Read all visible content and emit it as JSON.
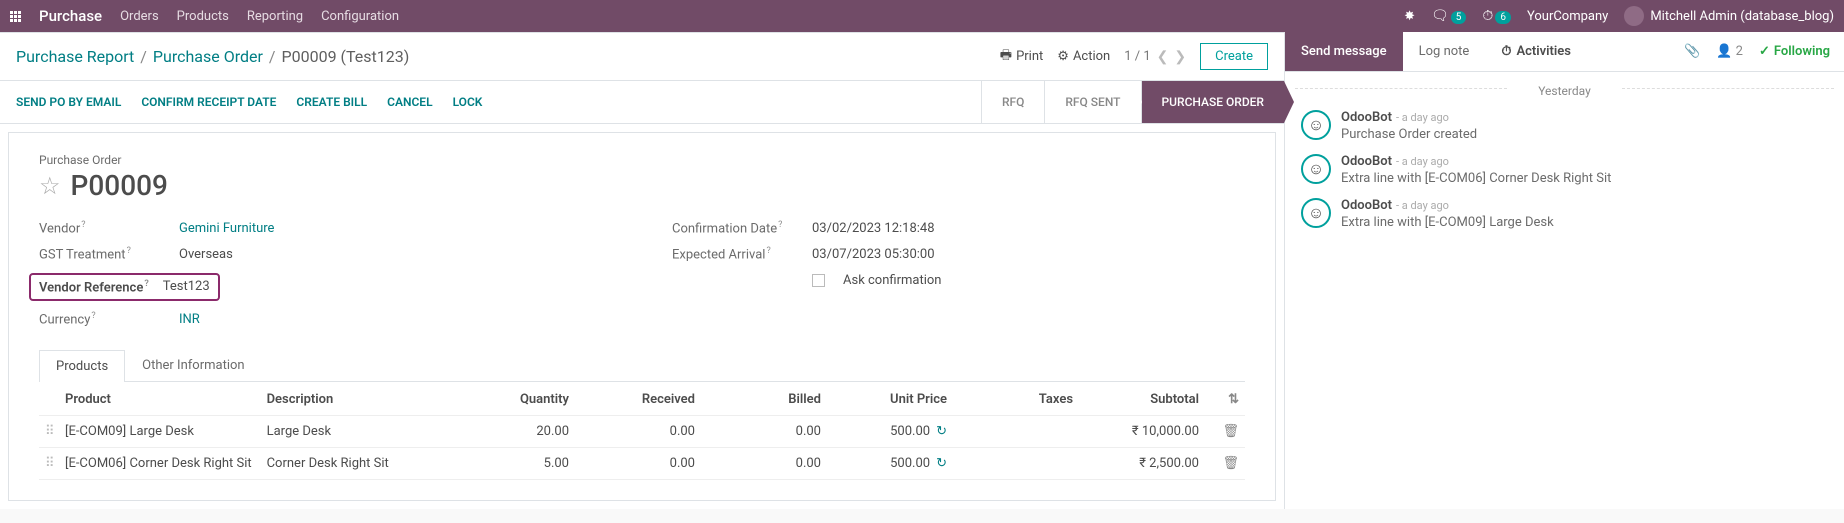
{
  "topbar": {
    "app": "Purchase",
    "menus": [
      "Orders",
      "Products",
      "Reporting",
      "Configuration"
    ],
    "messages_count": "5",
    "activities_count": "6",
    "company": "YourCompany",
    "user": "Mitchell Admin (database_blog)"
  },
  "breadcrumb": {
    "root": "Purchase Report",
    "mid": "Purchase Order",
    "current": "P00009 (Test123)"
  },
  "subhead": {
    "print": "Print",
    "action": "Action",
    "pager": "1 / 1",
    "create": "Create"
  },
  "status_actions": {
    "send_po": "SEND PO BY EMAIL",
    "confirm_date": "CONFIRM RECEIPT DATE",
    "create_bill": "CREATE BILL",
    "cancel": "CANCEL",
    "lock": "LOCK"
  },
  "status_steps": {
    "rfq": "RFQ",
    "rfq_sent": "RFQ SENT",
    "po": "PURCHASE ORDER"
  },
  "form": {
    "title_label": "Purchase Order",
    "title": "P00009",
    "labels": {
      "vendor": "Vendor",
      "gst": "GST Treatment",
      "vendor_ref": "Vendor Reference",
      "currency": "Currency",
      "confirm_date": "Confirmation Date",
      "expected": "Expected Arrival",
      "ask_conf": "Ask confirmation"
    },
    "values": {
      "vendor": "Gemini Furniture",
      "gst": "Overseas",
      "vendor_ref": "Test123",
      "currency": "INR",
      "confirm_date": "03/02/2023 12:18:48",
      "expected": "03/07/2023 05:30:00"
    }
  },
  "tabs": {
    "products": "Products",
    "other": "Other Information"
  },
  "grid": {
    "headers": {
      "product": "Product",
      "desc": "Description",
      "qty": "Quantity",
      "recv": "Received",
      "bill": "Billed",
      "price": "Unit Price",
      "tax": "Taxes",
      "sub": "Subtotal"
    },
    "rows": [
      {
        "product": "[E-COM09] Large Desk",
        "desc": "Large Desk",
        "qty": "20.00",
        "recv": "0.00",
        "bill": "0.00",
        "price": "500.00",
        "sub": "₹ 10,000.00"
      },
      {
        "product": "[E-COM06] Corner Desk Right Sit",
        "desc": "Corner Desk Right Sit",
        "qty": "5.00",
        "recv": "0.00",
        "bill": "0.00",
        "price": "500.00",
        "sub": "₹ 2,500.00"
      }
    ]
  },
  "chatter": {
    "send": "Send message",
    "log": "Log note",
    "activities": "Activities",
    "followers": "2",
    "following": "Following",
    "day": "Yesterday",
    "items": [
      {
        "author": "OdooBot",
        "time": "a day ago",
        "text": "Purchase Order created"
      },
      {
        "author": "OdooBot",
        "time": "a day ago",
        "text": "Extra line with [E-COM06] Corner Desk Right Sit"
      },
      {
        "author": "OdooBot",
        "time": "a day ago",
        "text": "Extra line with [E-COM09] Large Desk"
      }
    ]
  }
}
